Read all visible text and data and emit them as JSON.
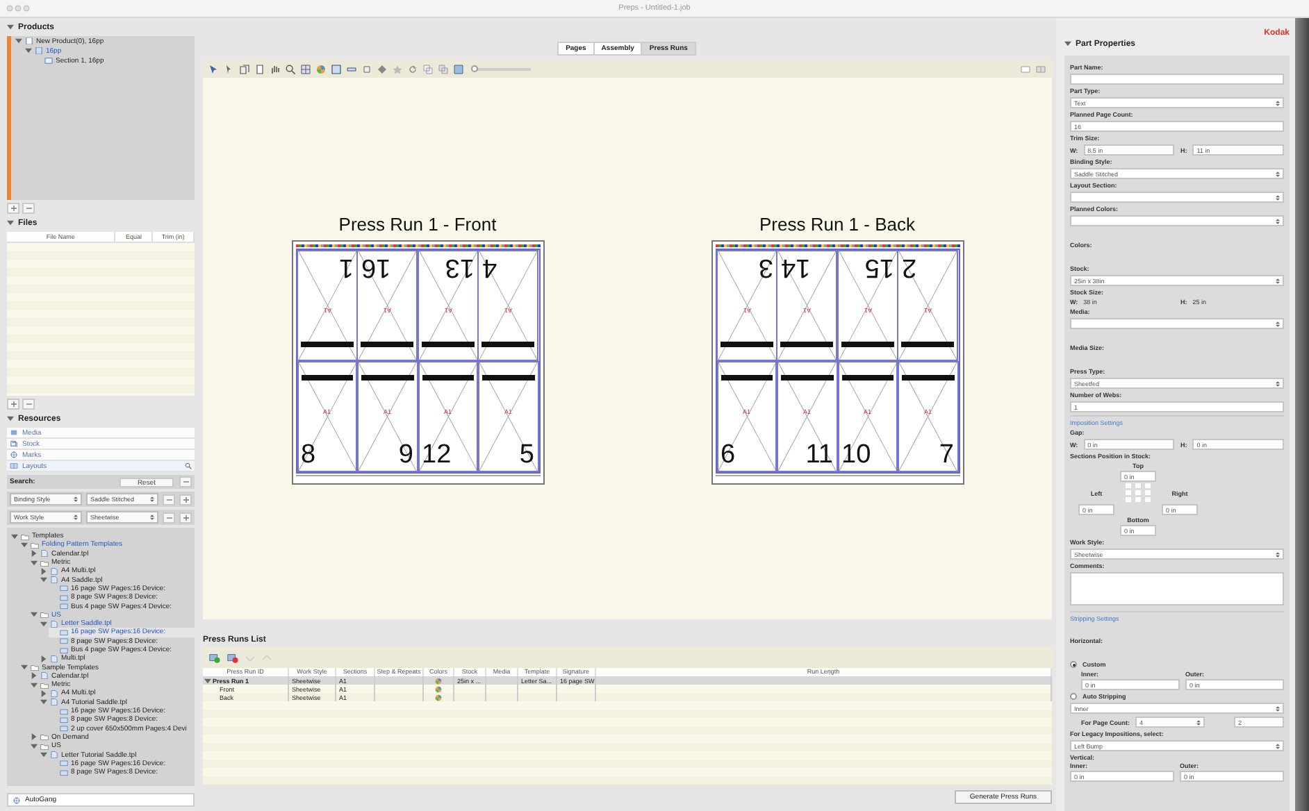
{
  "window": {
    "title": "Preps - Untitled-1.job"
  },
  "products": {
    "title": "Products",
    "tree": [
      {
        "label": "New Product(0), 16pp",
        "kind": "product",
        "selected": false,
        "expanded": true,
        "children": [
          {
            "label": "16pp",
            "kind": "part",
            "selected": true,
            "expanded": true,
            "children": [
              {
                "label": "Section 1, 16pp",
                "kind": "section",
                "selected": false
              }
            ]
          }
        ]
      }
    ]
  },
  "files": {
    "title": "Files",
    "columns": [
      "File Name",
      "Equal",
      "Trim (in)"
    ]
  },
  "resources": {
    "title": "Resources",
    "categories": [
      {
        "label": "Media",
        "kind": "media",
        "selected": false
      },
      {
        "label": "Stock",
        "kind": "stock",
        "selected": false
      },
      {
        "label": "Marks",
        "kind": "marks",
        "selected": false
      },
      {
        "label": "Layouts",
        "kind": "layouts",
        "selected": true
      }
    ],
    "search_label": "Search:",
    "reset": "Reset",
    "filters": [
      {
        "field": "Binding Style",
        "value": "Saddle Stitched"
      },
      {
        "field": "Work Style",
        "value": "Sheetwise"
      }
    ],
    "tree": [
      {
        "label": "Templates",
        "kind": "folder",
        "selected": false,
        "expanded": true,
        "children": [
          {
            "label": "Folding Pattern Templates",
            "kind": "folder",
            "selected": true,
            "expanded": true,
            "children": [
              {
                "label": "Calendar.tpl",
                "kind": "file",
                "selected": false,
                "expanded": false
              },
              {
                "label": "Metric",
                "kind": "folder",
                "selected": false,
                "expanded": true,
                "children": [
                  {
                    "label": "A4 Multi.tpl",
                    "kind": "file",
                    "selected": false,
                    "expanded": false
                  },
                  {
                    "label": "A4 Saddle.tpl",
                    "kind": "file",
                    "selected": false,
                    "expanded": true,
                    "children": [
                      {
                        "label": "16 page SW  Pages:16  Device:",
                        "kind": "layout",
                        "selected": false
                      },
                      {
                        "label": "8 page SW  Pages:8  Device:",
                        "kind": "layout",
                        "selected": false
                      },
                      {
                        "label": "Bus 4 page SW  Pages:4  Device:",
                        "kind": "layout",
                        "selected": false
                      }
                    ]
                  }
                ]
              },
              {
                "label": "US",
                "kind": "folder",
                "selected": true,
                "expanded": true,
                "children": [
                  {
                    "label": "Letter Saddle.tpl",
                    "kind": "file",
                    "selected": true,
                    "expanded": true,
                    "children": [
                      {
                        "label": "16 page SW  Pages:16  Device:",
                        "kind": "layout",
                        "selected": true
                      },
                      {
                        "label": "8 page SW  Pages:8  Device:",
                        "kind": "layout",
                        "selected": false
                      },
                      {
                        "label": "Bus 4 page SW  Pages:4  Device:",
                        "kind": "layout",
                        "selected": false
                      }
                    ]
                  },
                  {
                    "label": "Multi.tpl",
                    "kind": "file",
                    "selected": false,
                    "expanded": false
                  }
                ]
              }
            ]
          },
          {
            "label": "Sample Templates",
            "kind": "folder",
            "selected": false,
            "expanded": true,
            "children": [
              {
                "label": "Calendar.tpl",
                "kind": "file",
                "selected": false,
                "expanded": false
              },
              {
                "label": "Metric",
                "kind": "folder",
                "selected": false,
                "expanded": true,
                "children": [
                  {
                    "label": "A4 Multi.tpl",
                    "kind": "file",
                    "selected": false,
                    "expanded": false
                  },
                  {
                    "label": "A4 Tutorial Saddle.tpl",
                    "kind": "file",
                    "selected": false,
                    "expanded": true,
                    "children": [
                      {
                        "label": "16 page SW  Pages:16  Device:",
                        "kind": "layout",
                        "selected": false
                      },
                      {
                        "label": "8 page SW  Pages:8  Device:",
                        "kind": "layout",
                        "selected": false
                      },
                      {
                        "label": "2 up cover 650x500mm  Pages:4  Devi",
                        "kind": "layout",
                        "selected": false
                      }
                    ]
                  }
                ]
              },
              {
                "label": "On Demand",
                "kind": "folder",
                "selected": false,
                "expanded": false
              },
              {
                "label": "US",
                "kind": "folder",
                "selected": false,
                "expanded": true,
                "children": [
                  {
                    "label": "Letter Tutorial Saddle.tpl",
                    "kind": "file",
                    "selected": false,
                    "expanded": true,
                    "children": [
                      {
                        "label": "16 page SW  Pages:16  Device:",
                        "kind": "layout",
                        "selected": false
                      },
                      {
                        "label": "8 page SW  Pages:8  Device:",
                        "kind": "layout",
                        "selected": false
                      }
                    ]
                  }
                ]
              }
            ]
          }
        ]
      }
    ]
  },
  "autogang": {
    "label": "AutoGang"
  },
  "view_tabs": [
    {
      "label": "Pages",
      "selected": false
    },
    {
      "label": "Assembly",
      "selected": false
    },
    {
      "label": "Press Runs",
      "selected": true
    }
  ],
  "zoom_slider": {
    "level": 0.03
  },
  "sheets": [
    {
      "title": "Press Run 1 - Front",
      "pages": [
        {
          "number": "1",
          "section": "A1",
          "flipped": true
        },
        {
          "number": "16",
          "section": "A1",
          "flipped": true
        },
        {
          "number": "13",
          "section": "A1",
          "flipped": true
        },
        {
          "number": "4",
          "section": "A1",
          "flipped": true
        },
        {
          "number": "8",
          "section": "A1",
          "flipped": false
        },
        {
          "number": "9",
          "section": "A1",
          "flipped": false
        },
        {
          "number": "12",
          "section": "A1",
          "flipped": false
        },
        {
          "number": "5",
          "section": "A1",
          "flipped": false
        }
      ]
    },
    {
      "title": "Press Run 1 - Back",
      "pages": [
        {
          "number": "3",
          "section": "A1",
          "flipped": true
        },
        {
          "number": "14",
          "section": "A1",
          "flipped": true
        },
        {
          "number": "15",
          "section": "A1",
          "flipped": true
        },
        {
          "number": "2",
          "section": "A1",
          "flipped": true
        },
        {
          "number": "6",
          "section": "A1",
          "flipped": false
        },
        {
          "number": "11",
          "section": "A1",
          "flipped": false
        },
        {
          "number": "10",
          "section": "A1",
          "flipped": false
        },
        {
          "number": "7",
          "section": "A1",
          "flipped": false
        }
      ]
    }
  ],
  "press_runs_list": {
    "title": "Press Runs List",
    "columns": [
      "Press Run ID",
      "Work Style",
      "Sections",
      "Step & Repeats",
      "Colors",
      "Stock",
      "Media",
      "Template",
      "Signature",
      "Run Length"
    ],
    "rows": [
      {
        "id": "Press Run 1",
        "work_style": "Sheetwise",
        "sections": "A1",
        "colors": true,
        "stock": "25in x ...",
        "template": "Letter Sa...",
        "signature": "16 page SW",
        "expanded": true,
        "children": [
          {
            "id": "Front",
            "work_style": "Sheetwise",
            "sections": "A1",
            "colors": true
          },
          {
            "id": "Back",
            "work_style": "Sheetwise",
            "sections": "A1",
            "colors": true
          }
        ]
      }
    ]
  },
  "generate_button": "Generate Press Runs",
  "part_properties": {
    "logo": "Kodak",
    "title": "Part Properties",
    "fields": [
      {
        "kind": "text",
        "label": "Part Name:"
      },
      {
        "kind": "select",
        "label": "Part Type:",
        "value": "Text"
      },
      {
        "kind": "text",
        "label": "Planned Page Count:",
        "value": "16"
      },
      {
        "kind": "pair",
        "label": "Trim Size:",
        "items": [
          {
            "prefix": "W:",
            "value": "8.5 in"
          },
          {
            "prefix": "H:",
            "value": "11 in"
          }
        ]
      },
      {
        "kind": "select",
        "label": "Binding Style:",
        "value": "Saddle Stitched"
      },
      {
        "kind": "select",
        "label": "Layout Section:"
      },
      {
        "kind": "select",
        "label": "Planned Colors:"
      },
      {
        "kind": "label",
        "label": "Colors:"
      },
      {
        "kind": "select",
        "label": "Stock:",
        "value": "25in x 38in"
      },
      {
        "kind": "static_pair",
        "label": "Stock Size:",
        "items": [
          {
            "prefix": "W:",
            "value": "38 in"
          },
          {
            "prefix": "H:",
            "value": "25 in"
          }
        ]
      },
      {
        "kind": "select",
        "label": "Media:"
      },
      {
        "kind": "label",
        "label": "Media Size:"
      },
      {
        "kind": "select",
        "label": "Press Type:",
        "value": "Sheetfed"
      },
      {
        "kind": "text",
        "label": "Number of Webs:",
        "value": "1"
      },
      {
        "kind": "heading",
        "label": "Imposition Settings"
      },
      {
        "kind": "pair",
        "label": "Gap:",
        "items": [
          {
            "prefix": "W:",
            "value": "0 in"
          },
          {
            "prefix": "H:",
            "value": "0 in"
          }
        ]
      },
      {
        "kind": "position",
        "label": "Sections Position in Stock:",
        "top": {
          "label": "Top",
          "value": "0 in"
        },
        "left": {
          "label": "Left",
          "value": "0 in"
        },
        "right": {
          "label": "Right",
          "value": "0 in"
        },
        "bottom": {
          "label": "Bottom",
          "value": "0 in"
        }
      },
      {
        "kind": "select",
        "label": "Work Style:",
        "value": "Sheetwise"
      },
      {
        "kind": "textarea",
        "label": "Comments:"
      },
      {
        "kind": "heading",
        "label": "Stripping Settings"
      },
      {
        "kind": "label",
        "label": "Horizontal:"
      },
      {
        "kind": "radio",
        "label": "Custom",
        "selected": true
      },
      {
        "kind": "labeled_pair",
        "items": [
          {
            "label": "Inner:",
            "value": "0 in"
          },
          {
            "label": "Outer:",
            "value": "0 in"
          }
        ]
      },
      {
        "kind": "radio",
        "label": "Auto Stripping",
        "selected": false
      },
      {
        "kind": "select",
        "value": "Inner"
      },
      {
        "kind": "count",
        "label": "For Page Count:",
        "value": "4",
        "extra": "2"
      },
      {
        "kind": "select",
        "label": "For Legacy Impositions, select:",
        "value": "Left Bump"
      },
      {
        "kind": "labeled_pair",
        "label": "Vertical:",
        "items": [
          {
            "label": "Inner:",
            "value": "0 in"
          },
          {
            "label": "Outer:",
            "value": "0 in"
          }
        ]
      }
    ]
  }
}
